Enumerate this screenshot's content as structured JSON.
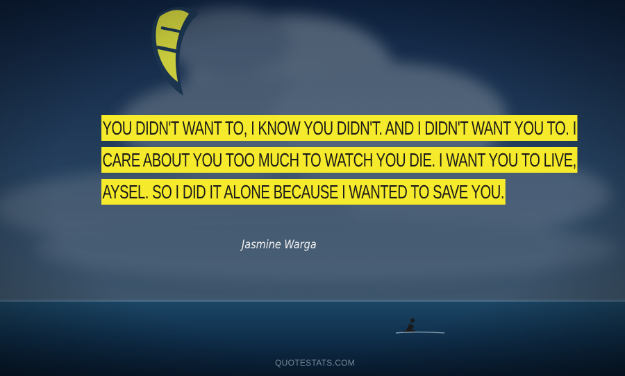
{
  "quote": {
    "lines": [
      "YOU DIDN'T WANT TO, I KNOW YOU DIDN'T. AND I DIDN'T WANT YOU TO. I",
      "CARE ABOUT YOU TOO MUCH TO WATCH YOU DIE. I WANT YOU TO LIVE,",
      "AYSEL. SO I DID IT ALONE BECAUSE I WANTED TO SAVE YOU."
    ],
    "highlight_color": "#f5ea2b"
  },
  "author": "Jasmine Warga",
  "source": "QUOTESTATS.COM",
  "icons": [
    "kite-icon",
    "kitesurfer-icon"
  ]
}
